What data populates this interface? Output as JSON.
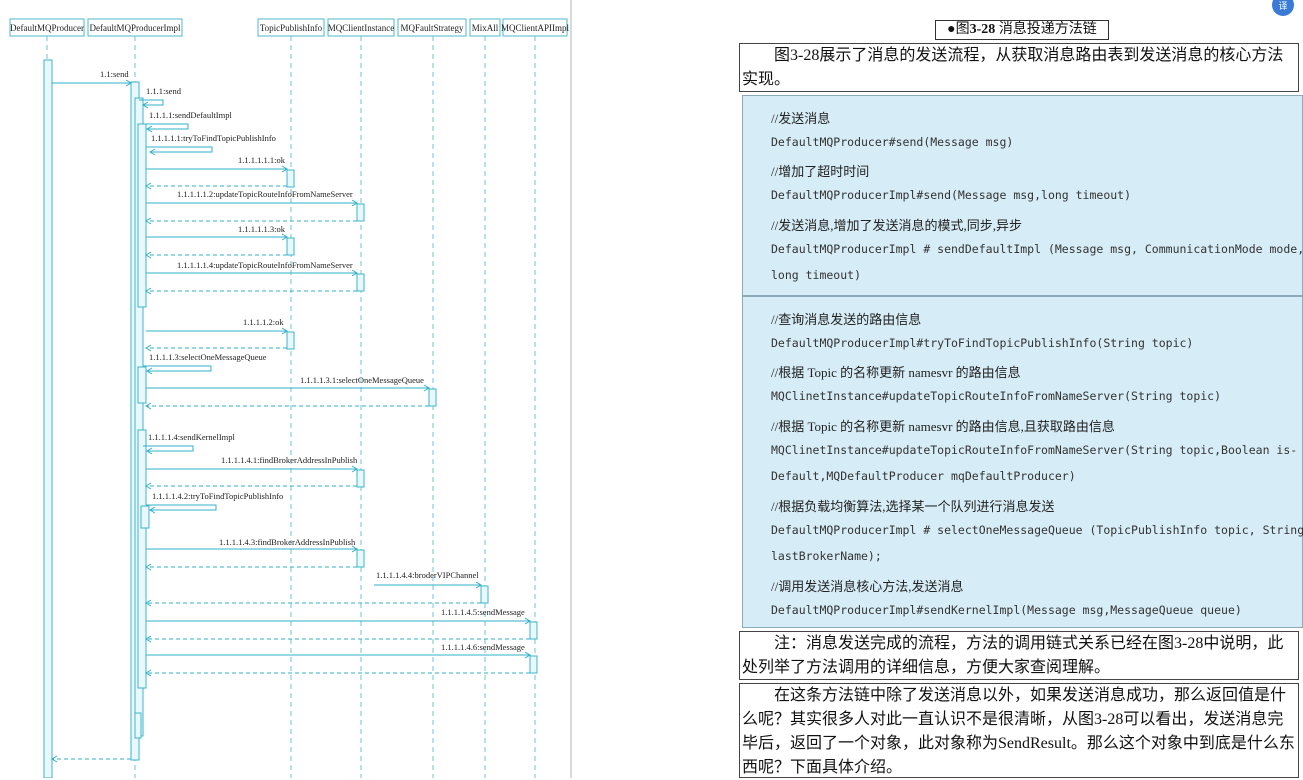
{
  "diagram": {
    "actors": [
      "DefaultMQProducer",
      "DefaultMQProducerImpl",
      "TopicPublishInfo",
      "MQClientInstance",
      "MQFaultStrategy",
      "MixAll",
      "MQClientAPIImpl"
    ],
    "messages": [
      {
        "label": "1.1:send"
      },
      {
        "label": "1.1.1:send"
      },
      {
        "label": "1.1.1.1:sendDefaultImpl"
      },
      {
        "label": "1.1.1.1.1:tryToFindTopicPublishInfo"
      },
      {
        "label": "1.1.1.1.1.1:ok"
      },
      {
        "label": "1.1.1.1.1.2:updateTopicRouteInfoFromNameServer"
      },
      {
        "label": "1.1.1.1.1.3:ok"
      },
      {
        "label": "1.1.1.1.1.4:updateTopicRouteInfoFromNameServer"
      },
      {
        "label": "1.1.1.1.2:ok"
      },
      {
        "label": "1.1.1.1.3:selectOneMessageQueue"
      },
      {
        "label": "1.1.1.1.3.1:selectOneMessageQueue"
      },
      {
        "label": "1.1.1.1.4:sendKernelImpl"
      },
      {
        "label": "1.1.1.1.4.1:findBrokerAddressInPublish"
      },
      {
        "label": "1.1.1.1.4.2:tryToFindTopicPublishInfo"
      },
      {
        "label": "1.1.1.1.4.3:findBrokerAddressInPublish"
      },
      {
        "label": "1.1.1.1.4.4:broderVIPChannel"
      },
      {
        "label": "1.1.1.1.4.5:sendMessage"
      },
      {
        "label": "1.1.1.1.4.6:sendMessage"
      }
    ]
  },
  "caption": {
    "prefix": "●图",
    "bold": "3-28",
    "rest": " 消息投递方法链"
  },
  "para1": "图3-28展示了消息的发送流程，从获取消息路由表到发送消息的核心方法实现。",
  "code_block1": [
    {
      "type": "comment",
      "text": "//发送消息"
    },
    {
      "type": "code",
      "text": "DefaultMQProducer#send(Message msg)"
    },
    {
      "type": "comment",
      "text": "//增加了超时时间"
    },
    {
      "type": "code",
      "text": "DefaultMQProducerImpl#send(Message msg,long timeout)"
    },
    {
      "type": "comment",
      "text": "//发送消息,增加了发送消息的模式,同步,异步"
    },
    {
      "type": "code",
      "text": "DefaultMQProducerImpl # sendDefaultImpl (Message msg, CommunicationMode mode,"
    },
    {
      "type": "code",
      "text": "long timeout)"
    }
  ],
  "code_block2": [
    {
      "type": "comment",
      "text": "//查询消息发送的路由信息"
    },
    {
      "type": "code",
      "text": "DefaultMQProducerImpl#tryToFindTopicPublishInfo(String topic)"
    },
    {
      "type": "comment",
      "text": "//根据 Topic 的名称更新 namesvr 的路由信息"
    },
    {
      "type": "code",
      "text": "MQClinetInstance#updateTopicRouteInfoFromNameServer(String topic)"
    },
    {
      "type": "comment",
      "text": "//根据 Topic 的名称更新 namesvr 的路由信息,且获取路由信息"
    },
    {
      "type": "code",
      "text": "MQClinetInstance#updateTopicRouteInfoFromNameServer(String topic,Boolean is-"
    },
    {
      "type": "code",
      "text": "Default,MQDefaultProducer mqDefaultProducer)"
    },
    {
      "type": "comment",
      "text": "//根据负载均衡算法,选择某一个队列进行消息发送"
    },
    {
      "type": "code",
      "text": "DefaultMQProducerImpl # selectOneMessageQueue (TopicPublishInfo topic, String"
    },
    {
      "type": "code",
      "text": "lastBrokerName);"
    },
    {
      "type": "comment",
      "text": "//调用发送消息核心方法,发送消息"
    },
    {
      "type": "code",
      "text": "DefaultMQProducerImpl#sendKernelImpl(Message msg,MessageQueue queue)"
    }
  ],
  "note": "注：消息发送完成的流程，方法的调用链式关系已经在图3-28中说明，此处列举了方法调用的详细信息，方便大家查阅理解。",
  "para2": "在这条方法链中除了发送消息以外，如果发送消息成功，那么返回值是什么呢？其实很多人对此一直认识不是很清晰，从图3-28可以看出，发送消息完毕后，返回了一个对象，此对象称为SendResult。那么这个对象中到底是什么东西呢？下面具体介绍。",
  "corner_icon": "translate-icon"
}
